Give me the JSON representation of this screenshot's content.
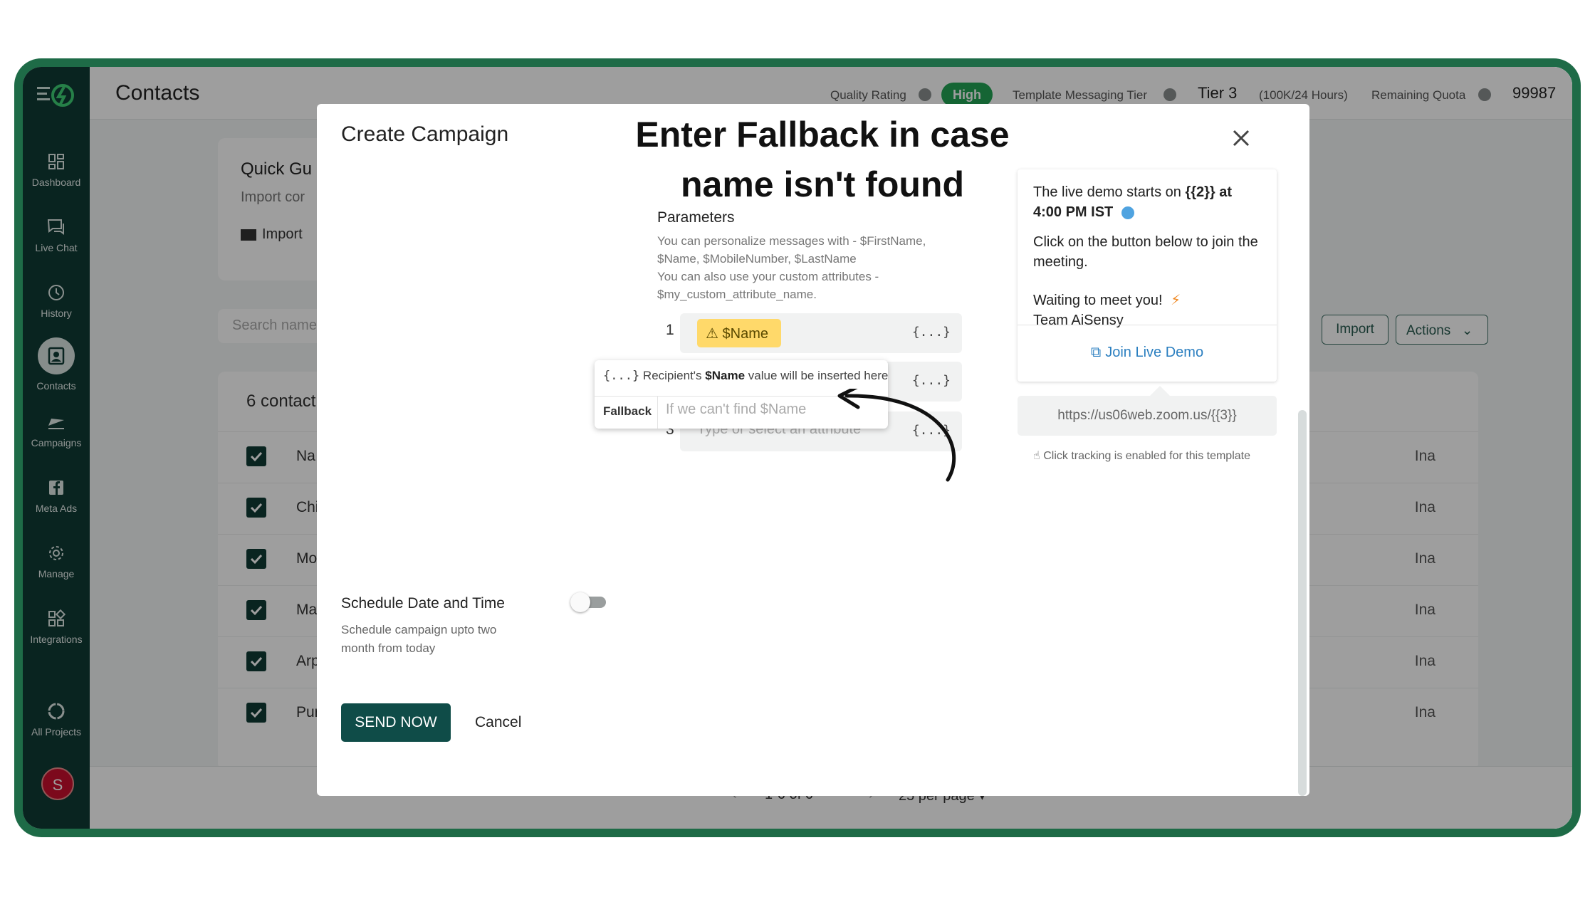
{
  "sidebar": {
    "items": [
      {
        "label": "Dashboard",
        "icon": "dashboard-icon"
      },
      {
        "label": "Live Chat",
        "icon": "chat-icon"
      },
      {
        "label": "History",
        "icon": "history-icon"
      },
      {
        "label": "Contacts",
        "icon": "contacts-icon"
      },
      {
        "label": "Campaigns",
        "icon": "campaigns-icon"
      },
      {
        "label": "Meta Ads",
        "icon": "facebook-icon"
      },
      {
        "label": "Manage",
        "icon": "gear-icon"
      },
      {
        "label": "Integrations",
        "icon": "integrations-icon"
      },
      {
        "label": "All Projects",
        "icon": "projects-icon"
      }
    ],
    "avatar_letter": "S"
  },
  "topbar": {
    "title": "Contacts",
    "quality_label": "Quality Rating",
    "quality_value": "High",
    "tier_label": "Template Messaging Tier",
    "tier_value": "Tier 3",
    "tier_detail": "(100K/24 Hours)",
    "quota_label": "Remaining Quota",
    "quota_value": "99987"
  },
  "background": {
    "quick_title": "Quick Gu",
    "quick_sub": "Import cor",
    "quick_import": "Import",
    "search_placeholder": "Search name",
    "import_btn": "Import",
    "actions_btn": "Actions",
    "contacts_count": "6 contact",
    "rows": [
      {
        "name": "Na",
        "status": "Ina"
      },
      {
        "name": "Chi",
        "status": "Ina"
      },
      {
        "name": "Mo",
        "status": "Ina"
      },
      {
        "name": "Ma",
        "status": "Ina"
      },
      {
        "name": "Arp",
        "status": "Ina"
      },
      {
        "name": "Pur",
        "status": "Ina"
      }
    ],
    "pager_range": "1-6 of 6",
    "pager_per_page": "25 per page"
  },
  "modal": {
    "title": "Create Campaign",
    "annotation_line1": "Enter Fallback in case",
    "annotation_line2": "name isn't found",
    "params_title": "Parameters",
    "params_help_1": "You can personalize messages with - $FirstName, $Name, $MobileNumber, $LastName",
    "params_help_2": "You can also use your custom attributes - $my_custom_attribute_name.",
    "param1_num": "1",
    "param1_chip": "$Name",
    "param3_num": "3",
    "param3_placeholder": "Type or select an attribute",
    "curly": "{...}",
    "fallback_info_prefix": "Recipient's",
    "fallback_info_name": "$Name",
    "fallback_info_suffix": "value will be inserted here",
    "fallback_label": "Fallback",
    "fallback_placeholder": "If we can't find $Name",
    "schedule_title": "Schedule Date and Time",
    "schedule_sub": "Schedule campaign upto two month from today",
    "send_btn": "SEND NOW",
    "cancel_btn": "Cancel"
  },
  "preview": {
    "line1a": "The live demo starts on",
    "line1b": "{{2}} at",
    "line2": "4:00 PM IST",
    "line3": "Click on the button below to join the meeting.",
    "line4": "Waiting to meet you!",
    "line5": "Team AiSensy",
    "link_label": "Join Live Demo",
    "url": "https://us06web.zoom.us/{{3}}",
    "tracking_note": "Click tracking is enabled for this template"
  },
  "colors": {
    "sidebar": "#0f3b35",
    "accent": "#0f4c48",
    "high_badge": "#23a455",
    "chip": "#ffd96a",
    "link": "#2b7fc0"
  }
}
